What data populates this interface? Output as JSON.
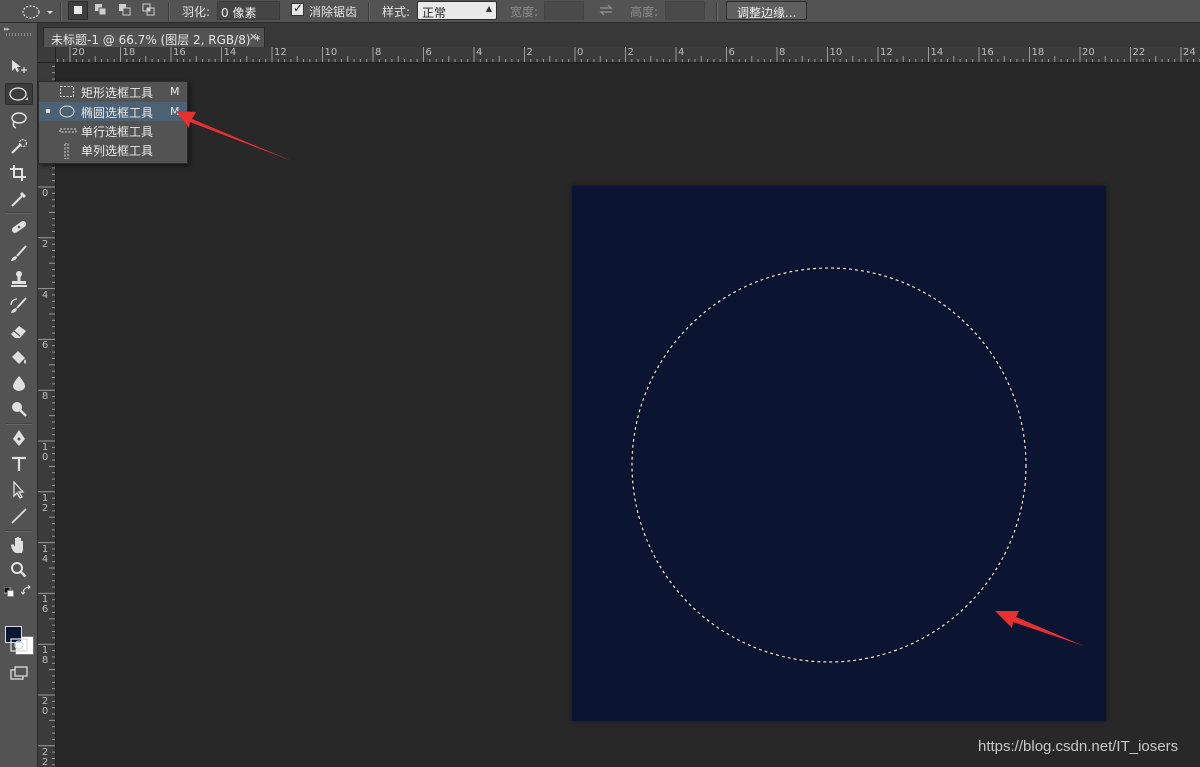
{
  "options_bar": {
    "feather_label": "羽化:",
    "feather_value": "0 像素",
    "antialias_label": "消除锯齿",
    "style_label": "样式:",
    "style_value": "正常",
    "width_label": "宽度:",
    "height_label": "高度:",
    "refine_edge_button": "调整边缘..."
  },
  "document_tab": {
    "title": "未标题-1 @ 66.7% (图层 2, RGB/8) *",
    "close_glyph": "×"
  },
  "rulers": {
    "horizontal_labels": [
      "20",
      "18",
      "16",
      "14",
      "12",
      "10",
      "8",
      "6",
      "4",
      "2",
      "0",
      "2",
      "4",
      "6",
      "8",
      "10",
      "12",
      "14",
      "16",
      "18",
      "20",
      "22",
      "24"
    ],
    "vertical_labels": [
      [
        "0"
      ],
      [
        "2"
      ],
      [
        "4"
      ],
      [
        "6"
      ],
      [
        "8"
      ],
      [
        "1",
        "0"
      ],
      [
        "1",
        "2"
      ],
      [
        "1",
        "4"
      ],
      [
        "1",
        "6"
      ],
      [
        "1",
        "8"
      ],
      [
        "2",
        "0"
      ],
      [
        "2",
        "2"
      ]
    ]
  },
  "tools": [
    {
      "name": "move-tool-icon"
    },
    {
      "name": "elliptical-marquee-tool-icon"
    },
    {
      "name": "lasso-tool-icon"
    },
    {
      "name": "quick-selection-tool-icon"
    },
    {
      "name": "crop-tool-icon"
    },
    {
      "name": "eyedropper-tool-icon"
    },
    {
      "name": "healing-brush-tool-icon"
    },
    {
      "name": "brush-tool-icon"
    },
    {
      "name": "clone-stamp-tool-icon"
    },
    {
      "name": "history-brush-tool-icon"
    },
    {
      "name": "eraser-tool-icon"
    },
    {
      "name": "paint-bucket-tool-icon"
    },
    {
      "name": "blur-tool-icon"
    },
    {
      "name": "dodge-tool-icon"
    },
    {
      "name": "pen-tool-icon"
    },
    {
      "name": "type-tool-icon"
    },
    {
      "name": "path-selection-tool-icon"
    },
    {
      "name": "line-tool-icon"
    },
    {
      "name": "hand-tool-icon"
    },
    {
      "name": "zoom-tool-icon"
    }
  ],
  "flyout_menu": [
    {
      "label": "矩形选框工具",
      "shortcut": "M",
      "icon": "rectangular-marquee-icon",
      "selected": false
    },
    {
      "label": "椭圆选框工具",
      "shortcut": "M",
      "icon": "elliptical-marquee-icon",
      "selected": true
    },
    {
      "label": "单行选框工具",
      "shortcut": "",
      "icon": "single-row-marquee-icon",
      "selected": false
    },
    {
      "label": "单列选框工具",
      "shortcut": "",
      "icon": "single-column-marquee-icon",
      "selected": false
    }
  ],
  "colors": {
    "foreground": "#0b1634",
    "background": "#ffffff",
    "canvas_fill": "#0b1532",
    "annotation_arrow": "#e8312f"
  },
  "watermark": "https://blog.csdn.net/IT_iosers"
}
